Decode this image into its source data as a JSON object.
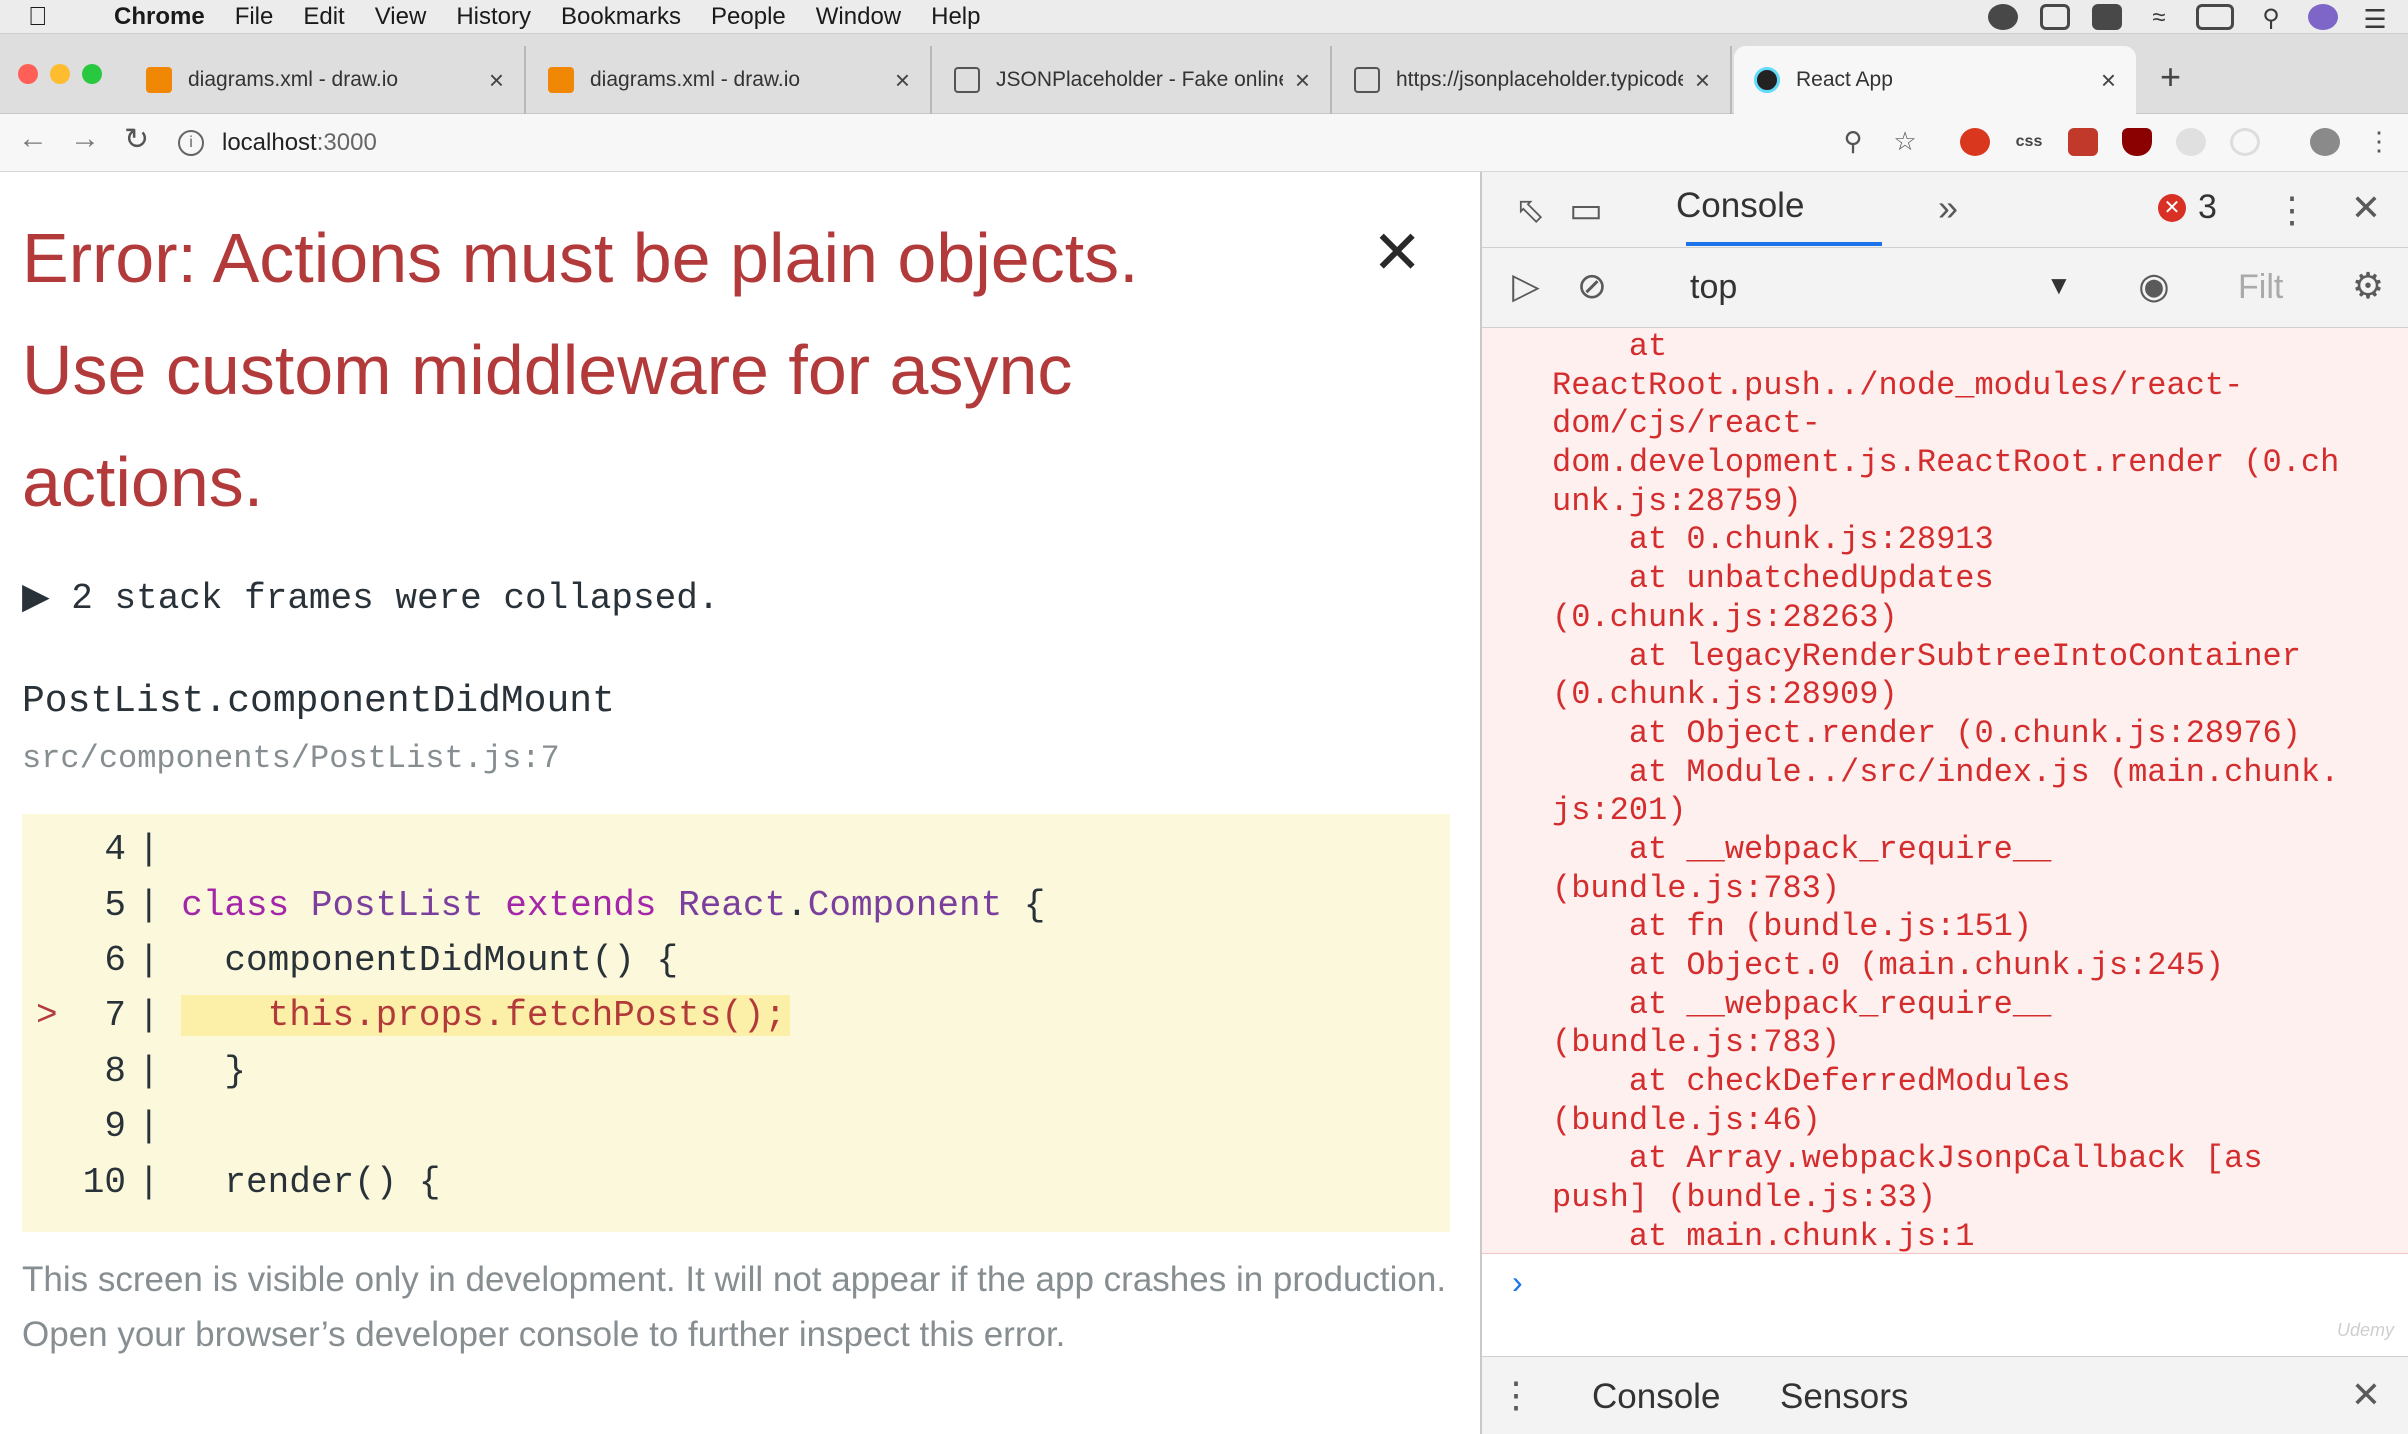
{
  "menubar": {
    "app": "Chrome",
    "items": [
      "File",
      "Edit",
      "View",
      "History",
      "Bookmarks",
      "People",
      "Window",
      "Help"
    ]
  },
  "tabs": [
    {
      "title": "diagrams.xml - draw.io",
      "icon": "drawio-icon",
      "color": "#f08705"
    },
    {
      "title": "diagrams.xml - draw.io",
      "icon": "drawio-icon",
      "color": "#f08705"
    },
    {
      "title": "JSONPlaceholder - Fake online",
      "icon": "placeholder-icon",
      "color": "#555555"
    },
    {
      "title": "https://jsonplaceholder.typicode",
      "icon": "placeholder-icon",
      "color": "#555555"
    },
    {
      "title": "React App",
      "icon": "react-icon",
      "color": "#61dafb"
    }
  ],
  "address": {
    "host": "localhost",
    "port": ":3000"
  },
  "error": {
    "title": "Error: Actions must be plain objects. Use custom middleware for async actions.",
    "collapsed": "▶ 2 stack frames were collapsed.",
    "function": "PostList.componentDidMount",
    "file": "src/components/PostList.js:7",
    "code": [
      {
        "marker": "",
        "num": "4",
        "text": ""
      },
      {
        "marker": "",
        "num": "5",
        "text": "class PostList extends React.Component {"
      },
      {
        "marker": "",
        "num": "6",
        "text": "  componentDidMount() {"
      },
      {
        "marker": ">",
        "num": "7",
        "text": "    this.props.fetchPosts();"
      },
      {
        "marker": "",
        "num": "8",
        "text": "  }"
      },
      {
        "marker": "",
        "num": "9",
        "text": ""
      },
      {
        "marker": "",
        "num": "10",
        "text": "  render() {"
      }
    ],
    "note_1": "This screen is visible only in development. It will not appear if the app crashes in production.",
    "note_2": "Open your browser’s developer console to further inspect this error."
  },
  "devtools": {
    "tab": "Console",
    "error_count": "3",
    "context": "top",
    "filter_placeholder": "Filt",
    "stack_lines": [
      "    at",
      "ReactRoot.push../node_modules/react-",
      "dom/cjs/react-",
      "dom.development.js.ReactRoot.render (0.ch",
      "unk.js:28759)",
      "    at 0.chunk.js:28913",
      "    at unbatchedUpdates",
      "(0.chunk.js:28263)",
      "    at legacyRenderSubtreeIntoContainer",
      "(0.chunk.js:28909)",
      "    at Object.render (0.chunk.js:28976)",
      "    at Module../src/index.js (main.chunk.",
      "js:201)",
      "    at __webpack_require__",
      "(bundle.js:783)",
      "    at fn (bundle.js:151)",
      "    at Object.0 (main.chunk.js:245)",
      "    at __webpack_require__",
      "(bundle.js:783)",
      "    at checkDeferredModules",
      "(bundle.js:46)",
      "    at Array.webpackJsonpCallback [as",
      "push] (bundle.js:33)",
      "    at main.chunk.js:1"
    ],
    "prompt": "›",
    "drawer_tabs": [
      "Console",
      "Sensors"
    ]
  },
  "colors": {
    "error_red": "#b33a3a",
    "console_red": "#d42d2d",
    "accent": "#1a73e8"
  }
}
